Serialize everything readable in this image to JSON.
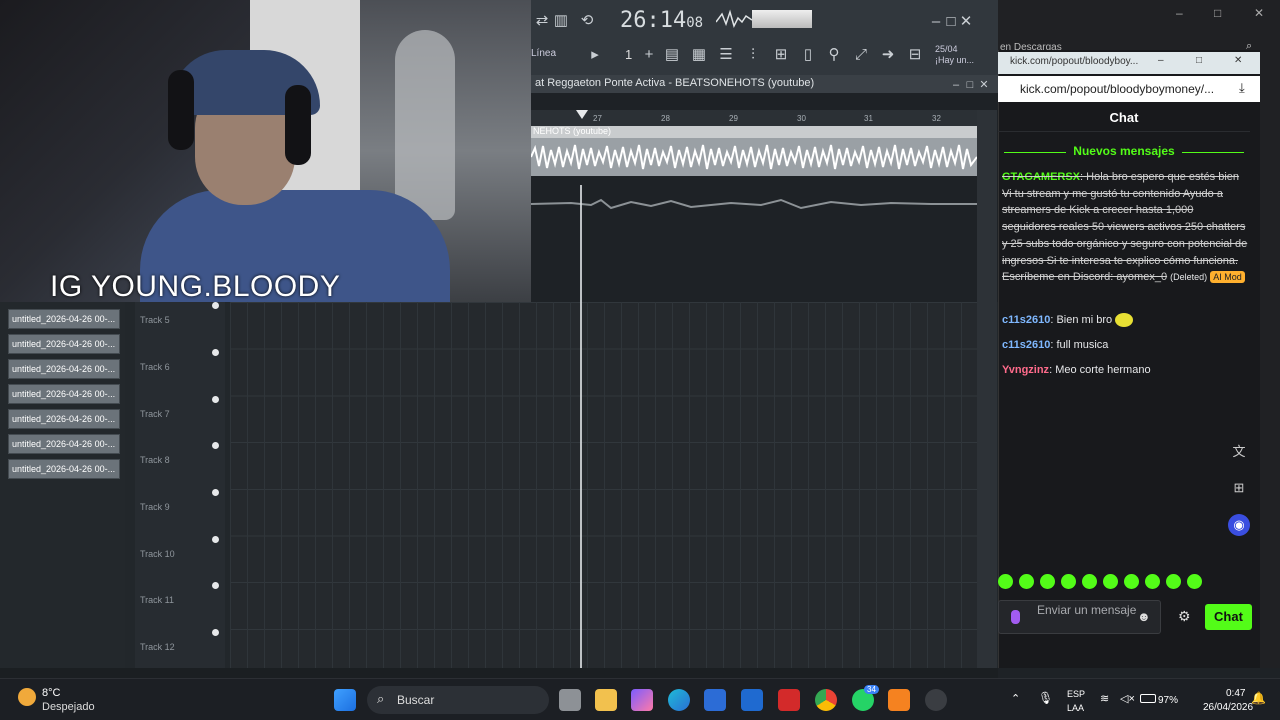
{
  "webcam": {
    "overlay_text": "IG YOUNG.BLOODY"
  },
  "fl_studio": {
    "time": "26:14",
    "time_frames": "08",
    "mode": "Línea",
    "step": "1",
    "hint_date": "25/04",
    "hint_text": "¡Hay un...",
    "playlist_title": "at Reggaeton Ponte Activa - BEATSONEHOTS (youtube)",
    "ruler_marks": [
      "27",
      "28",
      "29",
      "30",
      "31",
      "32"
    ],
    "audio_clip_label": "NEHOTS (youtube)",
    "patterns": [
      "untitled_2026-04-26 00-...",
      "untitled_2026-04-26 00-...",
      "untitled_2026-04-26 00-...",
      "untitled_2026-04-26 00-...",
      "untitled_2026-04-26 00-...",
      "untitled_2026-04-26 00-...",
      "untitled_2026-04-26 00-..."
    ],
    "tracks": [
      "Track 5",
      "Track 6",
      "Track 7",
      "Track 8",
      "Track 9",
      "Track 10",
      "Track 11",
      "Track 12"
    ]
  },
  "browser": {
    "tab_hint": "en Descargas",
    "popup_title": "kick.com/popout/bloodyboy...",
    "url": "kick.com/popout/bloodyboymoney/..."
  },
  "chat": {
    "header": "Chat",
    "new_messages": "Nuevos mensajes",
    "messages": [
      {
        "user": "GTAGAMERSX",
        "color": "#53fc18",
        "text": "Hola bro espero que estés bien Vi tu stream y me gustó tu contenido Ayudo a streamers de Kick a crecer hasta 1,000 seguidores reales 50 viewers activos 250 chatters y 25 subs todo orgánico y seguro con potencial de ingresos Si te interesa te explico cómo funciona. Escríbeme en Discord: ayomex_0",
        "deleted_tag": "(Deleted)",
        "badge": "AI Mod"
      },
      {
        "user": "c11s2610",
        "color": "#7fb8ff",
        "text": "Bien mi bro"
      },
      {
        "user": "c11s2610",
        "color": "#7fb8ff",
        "text": "full musica"
      },
      {
        "user": "Yvngzinz",
        "color": "#ff6b8b",
        "text": "Meo corte hermano"
      }
    ],
    "input_placeholder": "Enviar un mensaje",
    "send_label": "Chat"
  },
  "taskbar": {
    "temperature": "8°C",
    "weather": "Despejado",
    "search_placeholder": "Buscar",
    "lang_1": "ESP",
    "lang_2": "LAA",
    "battery": "97%",
    "time": "0:47",
    "date": "26/04/2026",
    "notification_count": "34"
  },
  "colors": {
    "kick_green": "#53fc18",
    "fl_bg": "#22272b"
  }
}
